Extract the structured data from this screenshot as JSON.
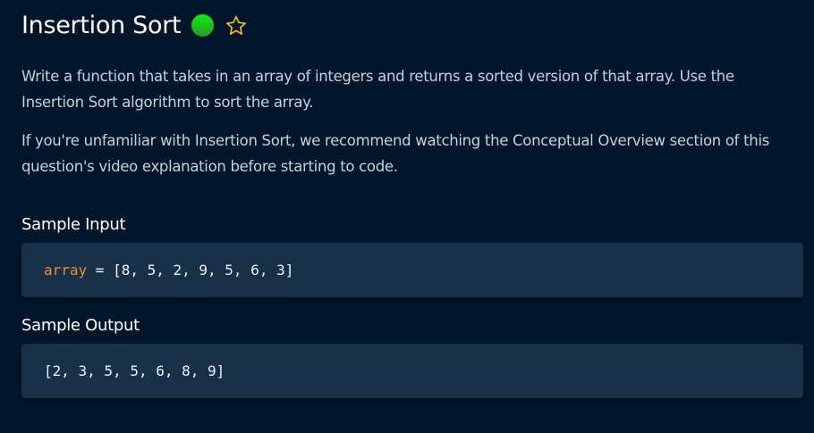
{
  "title": "Insertion Sort",
  "difficulty_color": "#1ed01e",
  "star_color": "#f0b429",
  "paragraphs": [
    "Write a function that takes in an array of integers and returns a sorted version of that array. Use the Insertion Sort algorithm to sort the array.",
    "If you're unfamiliar with Insertion Sort, we recommend watching the Conceptual Overview section of this question's video explanation before starting to code."
  ],
  "sample_input": {
    "heading": "Sample Input",
    "var": "array",
    "rest": " = [8, 5, 2, 9, 5, 6, 3]"
  },
  "sample_output": {
    "heading": "Sample Output",
    "code": "[2, 3, 5, 5, 6, 8, 9]"
  }
}
